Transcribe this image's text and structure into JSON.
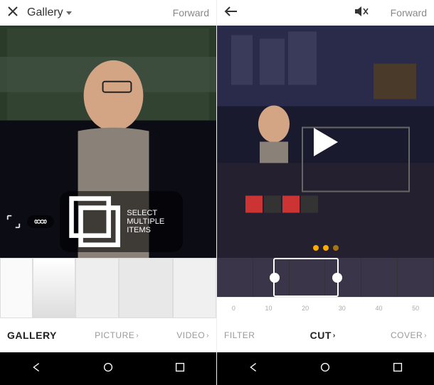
{
  "left": {
    "close_icon": "close",
    "dropdown_label": "Gallery",
    "forward_label": "Forward",
    "infinity_icon": "infinity",
    "select_multiple": "SELECT MULTIPLE ITEMS",
    "tabs": {
      "gallery": "GALLERY",
      "picture": "PICTURE",
      "video": "VIDEO"
    }
  },
  "right": {
    "back_icon": "back",
    "mute_icon": "volume-muted",
    "forward_label": "Forward",
    "ruler": [
      "0",
      "10",
      "20",
      "30",
      "40",
      "50"
    ],
    "tabs": {
      "filter": "FILTER",
      "cut": "CUT",
      "cover": "COVER"
    }
  }
}
